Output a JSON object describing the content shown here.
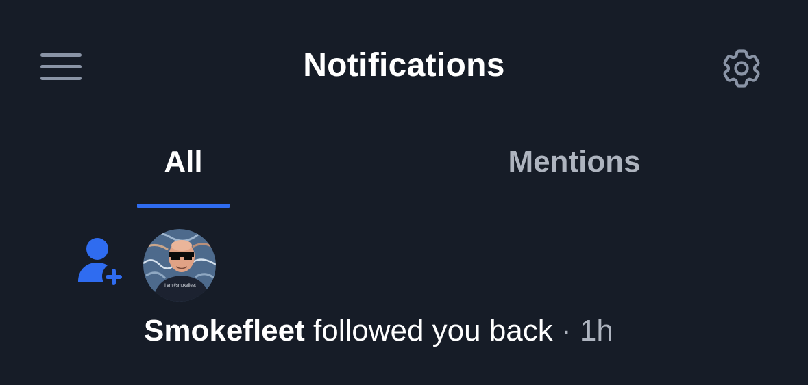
{
  "header": {
    "title": "Notifications",
    "menu_icon": "hamburger-menu-icon",
    "settings_icon": "gear-icon"
  },
  "tabs": [
    {
      "label": "All",
      "selected": true
    },
    {
      "label": "Mentions",
      "selected": false
    }
  ],
  "notifications": [
    {
      "type_icon": "user-plus-icon",
      "author": "Smokefleet",
      "action": "followed you back",
      "separator": "·",
      "time": "1h",
      "avatar_shirt_text": "I am #smokefleet"
    }
  ],
  "colors": {
    "background": "#161c27",
    "accent": "#2f6cf0",
    "muted_text": "#aeb4bf",
    "icon_gray": "#8a94a6",
    "divider": "#2e3644"
  }
}
